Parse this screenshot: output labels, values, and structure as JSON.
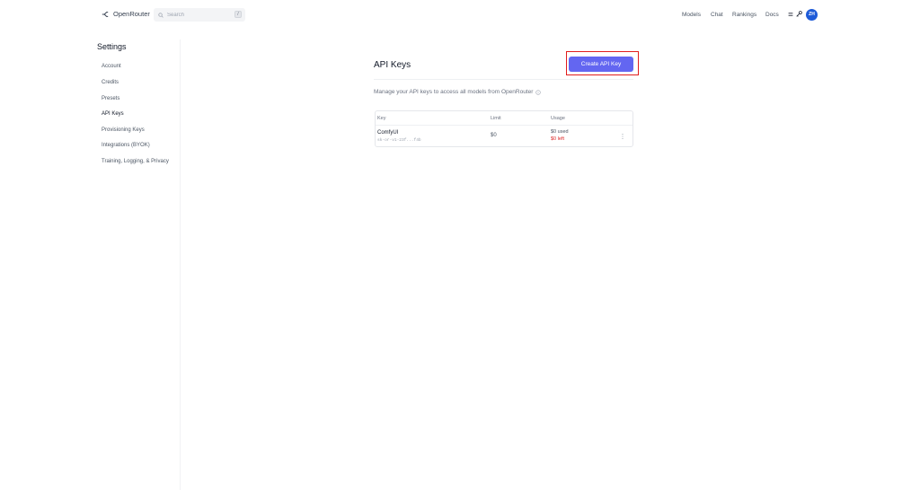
{
  "header": {
    "brand": "OpenRouter",
    "search": {
      "placeholder": "Search",
      "shortcut": "/"
    },
    "nav": [
      "Models",
      "Chat",
      "Rankings",
      "Docs"
    ],
    "avatar_initials": "ZH",
    "avatar_color": "#1e5bd8"
  },
  "sidebar": {
    "title": "Settings",
    "items": [
      {
        "label": "Account"
      },
      {
        "label": "Credits"
      },
      {
        "label": "Presets"
      },
      {
        "label": "API Keys",
        "active": true
      },
      {
        "label": "Provisioning Keys"
      },
      {
        "label": "Integrations (BYOK)"
      },
      {
        "label": "Training, Logging, & Privacy"
      }
    ]
  },
  "main": {
    "title": "API Keys",
    "create_button": "Create API Key",
    "description": "Manage your API keys to access all models from OpenRouter",
    "accent_color": "#6366f1",
    "table": {
      "columns": [
        "Key",
        "Limit",
        "Usage"
      ],
      "rows": [
        {
          "name": "ComfyUI",
          "masked_key": "sk-or-v1-23f...f4b",
          "limit": "$0",
          "used": "$0 used",
          "left": "$0 left"
        }
      ]
    }
  }
}
